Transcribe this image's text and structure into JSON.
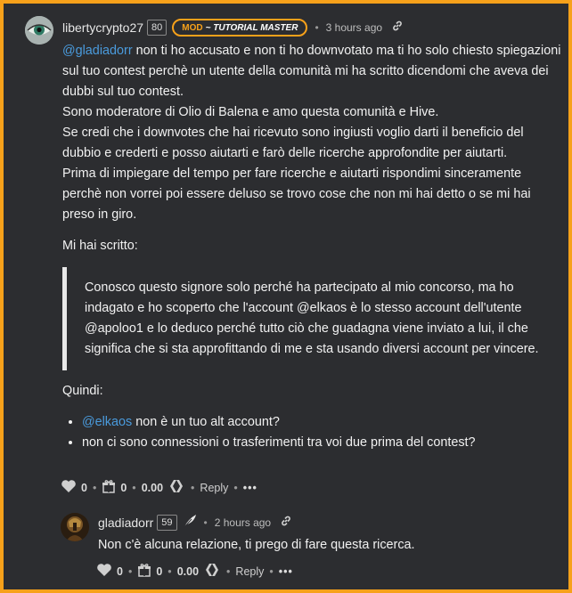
{
  "comment1": {
    "username": "libertycrypto27",
    "reputation": "80",
    "badge_mod": "MOD",
    "badge_title": "~ TUTORIAL MASTER",
    "time": "3 hours ago",
    "mention": "@gladiadorr",
    "p1_rest": " non ti ho accusato e non ti ho downvotato ma ti ho solo chiesto spiegazioni sul tuo contest perchè un utente della comunità mi ha scritto dicendomi che aveva dei dubbi sul tuo contest.",
    "p2": "Sono moderatore di Olio di Balena e amo questa comunità e Hive.",
    "p3": "Se credi che i downvotes che hai ricevuto sono ingiusti voglio darti il beneficio del dubbio e crederti e posso aiutarti e farò delle ricerche approfondite per aiutarti.",
    "p4": "Prima di impiegare del tempo per fare ricerche e aiutarti rispondimi sinceramente perchè non vorrei poi essere deluso se trovo cose che non mi hai detto o se mi hai preso in giro.",
    "intro_quote": "Mi hai scritto:",
    "quote": "Conosco questo signore solo perché ha partecipato al mio concorso, ma ho indagato e ho scoperto che l'account @elkaos è lo stesso account dell'utente @apoloo1 e lo deduco perché tutto ciò che guadagna viene inviato a lui, il che significa che si sta approfittando di me e sta usando diversi account per vincere.",
    "quindi": "Quindi:",
    "bullet1_mention": "@elkaos",
    "bullet1_rest": " non è un tuo alt account?",
    "bullet2": "non ci sono connessioni o trasferimenti tra voi due prima del contest?",
    "likes": "0",
    "tips": "0",
    "payout": "0.00",
    "reply": "Reply",
    "more": "•••"
  },
  "comment2": {
    "username": "gladiadorr",
    "reputation": "59",
    "time": "2 hours ago",
    "text": "Non c'è alcuna relazione, ti prego di fare questa ricerca.",
    "likes": "0",
    "tips": "0",
    "payout": "0.00",
    "reply": "Reply",
    "more": "•••"
  },
  "colors": {
    "accent": "#f7a11a",
    "mention": "#4a9bdd",
    "background": "#2c2d30"
  },
  "icons": [
    "eye-avatar-icon",
    "feather-icon",
    "link-icon",
    "heart-icon",
    "gift-icon",
    "hive-icon"
  ]
}
